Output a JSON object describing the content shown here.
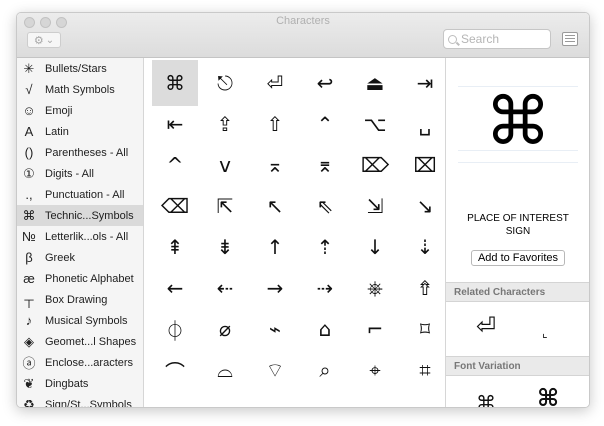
{
  "window": {
    "title": "Characters"
  },
  "toolbar": {
    "action_icon": "gear-icon",
    "action_caret": "⌄",
    "search_placeholder": "Search",
    "view_icon": "list-view-icon"
  },
  "sidebar": {
    "items": [
      {
        "icon": "✳",
        "label": "Bullets/Stars"
      },
      {
        "icon": "√",
        "label": "Math Symbols"
      },
      {
        "icon": "☺",
        "label": "Emoji"
      },
      {
        "icon": "A",
        "label": "Latin"
      },
      {
        "icon": "()",
        "label": "Parentheses - All"
      },
      {
        "icon": "①",
        "label": "Digits - All"
      },
      {
        "icon": ".,",
        "label": "Punctuation - All"
      },
      {
        "icon": "⌘",
        "label": "Technic...Symbols",
        "selected": true
      },
      {
        "icon": "№",
        "label": "Letterlik...ols - All"
      },
      {
        "icon": "β",
        "label": "Greek"
      },
      {
        "icon": "æ",
        "label": "Phonetic Alphabet"
      },
      {
        "icon": "┬",
        "label": "Box Drawing"
      },
      {
        "icon": "♪",
        "label": "Musical Symbols"
      },
      {
        "icon": "◈",
        "label": "Geomet...l Shapes"
      },
      {
        "icon": "ⓐ",
        "label": "Enclose...aracters"
      },
      {
        "icon": "❦",
        "label": "Dingbats"
      },
      {
        "icon": "♻",
        "label": "Sign/St...Symbols"
      }
    ]
  },
  "grid": {
    "rows": [
      [
        "⌘",
        "⎋",
        "⏎",
        "↩",
        "⏏",
        "⇥"
      ],
      [
        "⇤",
        "⇪",
        "⇧",
        "⌃",
        "⌥",
        "␣"
      ],
      [
        "^",
        "v",
        "⌅",
        "⌆",
        "⌦",
        "⌧"
      ],
      [
        "⌫",
        "⇱",
        "↖",
        "⇖",
        "⇲",
        "↘"
      ],
      [
        "⇞",
        "⇟",
        "↑",
        "⇡",
        "↓",
        "⇣"
      ],
      [
        "←",
        "⇠",
        "→",
        "⇢",
        "⎈",
        "⇮"
      ],
      [
        "⏀",
        "⌀",
        "⌁",
        "⌂",
        "⌐",
        "⌑"
      ],
      [
        "⌒",
        "⌓",
        "⌔",
        "⌕",
        "⌖",
        "⌗"
      ]
    ],
    "selected_glyph": "⌘"
  },
  "detail": {
    "glyph": "⌘",
    "name_line1": "PLACE OF INTEREST",
    "name_line2": "SIGN",
    "favorites_label": "Add to Favorites",
    "related_header": "Related Characters",
    "related_glyphs": [
      "⏎",
      "⌞"
    ],
    "variation_header": "Font Variation",
    "variation_glyphs": [
      "⌘",
      "⌘"
    ]
  }
}
